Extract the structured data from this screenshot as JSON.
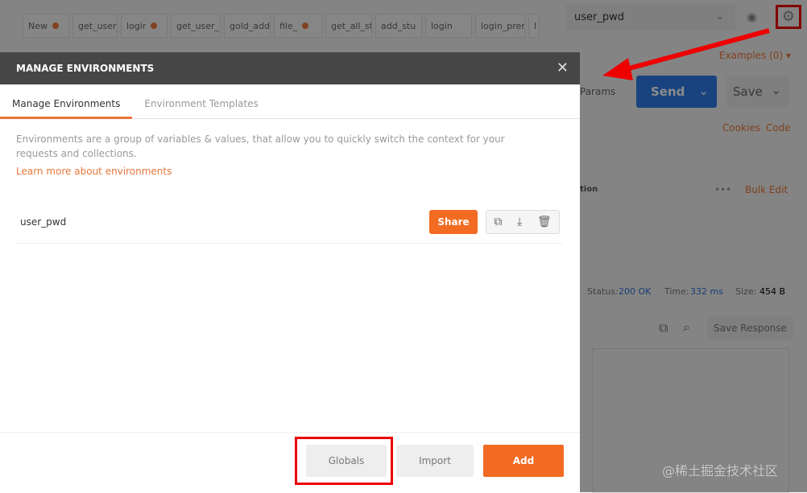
{
  "background": {
    "tabs": [
      {
        "label": "New",
        "dot": true
      },
      {
        "label": "get_user_i",
        "dot": false
      },
      {
        "label": "logir",
        "dot": true
      },
      {
        "label": "get_user_i",
        "dot": false
      },
      {
        "label": "gold_add",
        "dot": false
      },
      {
        "label": "file_",
        "dot": true
      },
      {
        "label": "get_all_stu",
        "dot": false
      },
      {
        "label": "add_stu",
        "dot": false
      },
      {
        "label": "login",
        "dot": false
      },
      {
        "label": "login_prer",
        "dot": false
      },
      {
        "label": "l",
        "dot": false
      }
    ],
    "environment": "user_pwd",
    "examples": "Examples (0) ▾",
    "params": "Params",
    "send": "Send",
    "save": "Save",
    "cookies": "Cookies",
    "code": "Code",
    "description_col": "tion",
    "bulk_edit": "Bulk Edit",
    "status_label": "Status:",
    "status": "200 OK",
    "time_label": "Time:",
    "time": "332 ms",
    "size_label": "Size:",
    "size": "454 B",
    "save_response": "Save Response"
  },
  "modal": {
    "title": "MANAGE ENVIRONMENTS",
    "tabs": [
      "Manage Environments",
      "Environment Templates"
    ],
    "description": "Environments are a group of variables & values, that allow you to quickly switch the context for your requests and collections.",
    "learn_more": "Learn more about environments",
    "environments": [
      {
        "name": "user_pwd",
        "share": "Share"
      }
    ],
    "footer": {
      "globals": "Globals",
      "import": "Import",
      "add": "Add"
    }
  },
  "watermark": "@稀土掘金技术社区",
  "colors": {
    "accent": "#f26b22",
    "send": "#2c7be5",
    "header": "#464646",
    "annotation": "#ee0000"
  }
}
